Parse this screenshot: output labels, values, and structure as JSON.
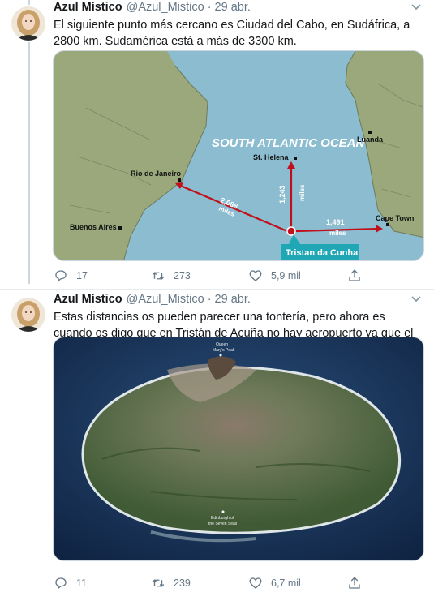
{
  "tweets": [
    {
      "name": "Azul Místico",
      "handle": "@Azul_Mistico",
      "sep": "·",
      "date": "29 abr.",
      "text": "El siguiente punto más cercano es Ciudad del Cabo, en Sudáfrica, a 2800 km. Sudamérica está a más de 3300 km.",
      "map": {
        "ocean": "SOUTH ATLANTIC OCEAN",
        "cities": {
          "rio": "Rio de Janeiro",
          "buenos_aires": "Buenos Aires",
          "st_helena": "St. Helena",
          "luanda": "Luanda",
          "cape_town": "Cape Town"
        },
        "distances": {
          "rio_num": "2,088",
          "rio_unit": "miles",
          "helena_num": "1,243",
          "helena_unit": "miles",
          "cape_num": "1,491",
          "cape_unit": "miles"
        },
        "island": "Tristan da Cunha",
        "colors": {
          "sea": "#8bbcd0",
          "land": "#9aa87c",
          "route": "#c0101b",
          "label_bg": "#20a7b5"
        }
      },
      "actions": {
        "replies": "17",
        "retweets": "273",
        "likes": "5,9 mil"
      }
    },
    {
      "name": "Azul Místico",
      "handle": "@Azul_Mistico",
      "sep": "·",
      "date": "29 abr.",
      "text": "Estas distancias os pueden parecer una tontería, pero ahora es cuando os digo que en Tristán de Acuña no hay aeropuerto ya que el terreno hace que sea imposible aterrizar 😅",
      "photo": {
        "top_label_1": "Queen",
        "top_label_2": "Mary's Peak",
        "bottom_label_1": "Edinburgh of",
        "bottom_label_2": "the Seven Seas"
      },
      "actions": {
        "replies": "11",
        "retweets": "239",
        "likes": "6,7 mil"
      }
    }
  ]
}
